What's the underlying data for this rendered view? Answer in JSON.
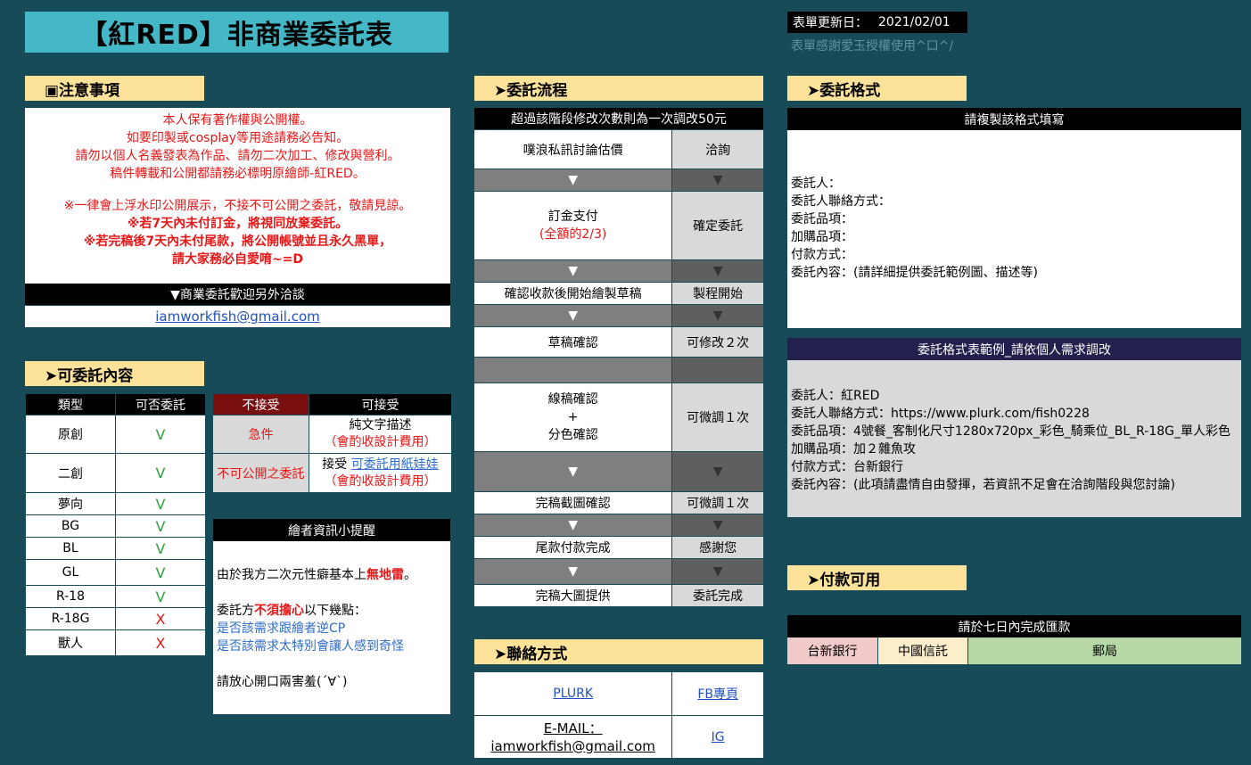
{
  "title": "【紅RED】非商業委託表",
  "update": {
    "label": "表單更新日：",
    "date": "2021/02/01",
    "credit": "表單感謝愛玉授權使用^口^/"
  },
  "notice": {
    "heading": "▣注意事項",
    "lines_normal": [
      "本人保有著作權與公開權。",
      "如要印製或cosplay等用途請務必告知。",
      "請勿以個人名義發表為作品、請勿二次加工、修改與營利。",
      "稿件轉載和公開都請務必標明原繪師-紅RED。"
    ],
    "line_wm": "※一律會上浮水印公開展示，不接不可公開之委託，敬請見諒。",
    "line_deposit": "※若7天內未付訂金，將視同放棄委託。",
    "line_final1": "※若完稿後7天內未付尾款，將公開帳號並且永久黑單，",
    "line_final2": "請大家務必自愛唷~=D",
    "biz_label": "▼商業委託歡迎另外洽談",
    "biz_email": "iamworkfish@gmail.com"
  },
  "content": {
    "heading": "➤可委託內容",
    "col_type": "類型",
    "col_ok": "可否委託",
    "rows": [
      {
        "type": "原創",
        "mark": "V",
        "ok": true
      },
      {
        "type": "二創",
        "mark": "V",
        "ok": true
      },
      {
        "type": "夢向",
        "mark": "V",
        "ok": true
      },
      {
        "type": "BG",
        "mark": "V",
        "ok": true
      },
      {
        "type": "BL",
        "mark": "V",
        "ok": true
      },
      {
        "type": "GL",
        "mark": "V",
        "ok": true
      },
      {
        "type": "R-18",
        "mark": "V",
        "ok": true
      },
      {
        "type": "R-18G",
        "mark": "X",
        "ok": false
      },
      {
        "type": "獸人",
        "mark": "X",
        "ok": false
      }
    ],
    "no_label": "不接受",
    "yes_label": "可接受",
    "no1": "急件",
    "no2": "不可公開之委託",
    "yes1": "純文字描述",
    "yes1_note": "（會酌收設計費用）",
    "yes2_prefix": "接受 ",
    "yes2_link": "可委託用紙娃娃",
    "yes2_note": "（會酌收設計費用）"
  },
  "painter": {
    "heading": "繪者資訊小提醒",
    "l1_pre": "由於我方二次元性癖基本上",
    "l1_red": "無地雷",
    "l1_post": "。",
    "l2_pre": "委託方",
    "l2_red": "不須擔心",
    "l2_post": "以下幾點：",
    "l3": "是否該需求跟繪者逆CP",
    "l4": "是否該需求太特別會讓人感到奇怪",
    "l5": "請放心開口兩害羞(´∀`)"
  },
  "flow": {
    "heading": "➤委託流程",
    "note": "超過該階段修改次數則為一次調改50元",
    "arrow": "▼",
    "step1": "噗浪私訊討論估價",
    "status1": "洽詢",
    "step2": "訂金支付",
    "step2_note": "(全額的2/3)",
    "status2": "確定委託",
    "step3": "確認收款後開始繪製草稿",
    "status3": "製程開始",
    "step4": "草稿確認",
    "status4": "可修改２次",
    "step5a": "線稿確認",
    "step5b": "+",
    "step5c": "分色確認",
    "status5": "可微調１次",
    "step6": "完稿截圖確認",
    "status6": "可微調１次",
    "step7": "尾款付款完成",
    "status7": "感謝您",
    "step8": "完稿大圖提供",
    "status8": "委託完成"
  },
  "contact": {
    "heading": "➤聯絡方式",
    "plurk": "PLURK",
    "fb": "FB專頁",
    "email_label": "E-MAIL：",
    "email": "iamworkfish@gmail.com",
    "ig": "IG"
  },
  "format": {
    "heading": "➤委託格式",
    "copy_note": "請複製該格式填寫",
    "lines": [
      "委託人：",
      "委託人聯絡方式：",
      "委託品項：",
      "加購品項：",
      "付款方式：",
      "委託內容：(請詳細提供委託範例圖、描述等)"
    ],
    "example_heading": "委託格式表範例_請依個人需求調改",
    "example_lines": [
      "委託人：紅RED",
      "委託人聯絡方式：https://www.plurk.com/fish0228",
      "委託品項：4號餐_客制化尺寸1280x720px_彩色_騎乘位_BL_R-18G_單人彩色",
      "加購品項：加２雜魚攻",
      "付款方式：台新銀行",
      "委託內容：(此項請盡情自由發揮，若資訊不足會在洽詢階段與您討論)"
    ]
  },
  "payment": {
    "heading": "➤付款可用",
    "note": "請於七日內完成匯款",
    "bank1": "台新銀行",
    "bank2": "中國信託",
    "bank3": "郵局"
  },
  "colors": {
    "bg": "#174b57",
    "banner": "#44b8c6",
    "section": "#fde29a",
    "red": "#e61717",
    "green": "#2fa23c",
    "blue": "#2f6cc7",
    "navy": "#24204d",
    "bank1": "#f1c9c9",
    "bank2": "#fdeecb",
    "bank3": "#b7d9a6"
  }
}
